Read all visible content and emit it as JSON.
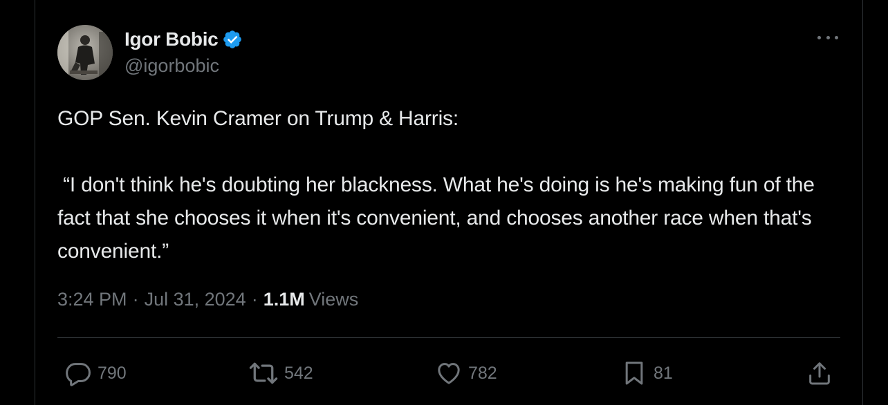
{
  "author": {
    "display_name": "Igor Bobic",
    "handle": "@igorbobic",
    "verified": true
  },
  "tweet": {
    "line1": "GOP Sen. Kevin Cramer on Trump & Harris:",
    "line2": " “I don't think he's doubting her blackness. What he's doing is he's making fun of the fact that she chooses it when it's convenient, and chooses another race when that's convenient.”"
  },
  "meta": {
    "time": "3:24 PM",
    "date": "Jul 31, 2024",
    "views_count": "1.1M",
    "views_label": "Views"
  },
  "actions": {
    "replies": "790",
    "reposts": "542",
    "likes": "782",
    "bookmarks": "81"
  },
  "colors": {
    "background": "#000000",
    "text": "#e7e9ea",
    "secondary": "#71767b",
    "verified": "#1d9bf0",
    "border": "#2f3336"
  },
  "icons": [
    "verified-badge-icon",
    "more-icon",
    "reply-icon",
    "repost-icon",
    "like-icon",
    "bookmark-icon",
    "share-icon"
  ]
}
